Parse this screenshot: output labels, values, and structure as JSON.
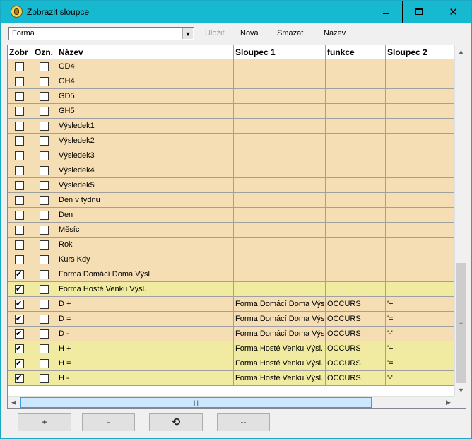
{
  "window": {
    "title": "Zobrazit sloupce",
    "minimize_icon": "minimize-icon",
    "maximize_icon": "maximize-icon",
    "close_icon": "close-icon"
  },
  "toolbar": {
    "combo_value": "Forma",
    "save_label": "Uložit",
    "new_label": "Nová",
    "delete_label": "Smazat",
    "name_label": "Název"
  },
  "columns": [
    "Zobr",
    "Ozn.",
    "Název",
    "Sloupec 1",
    "funkce",
    "Sloupec 2"
  ],
  "rows": [
    {
      "show": false,
      "mark": false,
      "name": "GD4",
      "col1": "",
      "func": "",
      "col2": "",
      "color": "tan"
    },
    {
      "show": false,
      "mark": false,
      "name": "GH4",
      "col1": "",
      "func": "",
      "col2": "",
      "color": "tan"
    },
    {
      "show": false,
      "mark": false,
      "name": "GD5",
      "col1": "",
      "func": "",
      "col2": "",
      "color": "tan"
    },
    {
      "show": false,
      "mark": false,
      "name": "GH5",
      "col1": "",
      "func": "",
      "col2": "",
      "color": "tan"
    },
    {
      "show": false,
      "mark": false,
      "name": "Výsledek1",
      "col1": "",
      "func": "",
      "col2": "",
      "color": "tan"
    },
    {
      "show": false,
      "mark": false,
      "name": "Výsledek2",
      "col1": "",
      "func": "",
      "col2": "",
      "color": "tan"
    },
    {
      "show": false,
      "mark": false,
      "name": "Výsledek3",
      "col1": "",
      "func": "",
      "col2": "",
      "color": "tan"
    },
    {
      "show": false,
      "mark": false,
      "name": "Výsledek4",
      "col1": "",
      "func": "",
      "col2": "",
      "color": "tan"
    },
    {
      "show": false,
      "mark": false,
      "name": "Výsledek5",
      "col1": "",
      "func": "",
      "col2": "",
      "color": "tan"
    },
    {
      "show": false,
      "mark": false,
      "name": "Den v týdnu",
      "col1": "",
      "func": "",
      "col2": "",
      "color": "tan"
    },
    {
      "show": false,
      "mark": false,
      "name": "Den",
      "col1": "",
      "func": "",
      "col2": "",
      "color": "tan"
    },
    {
      "show": false,
      "mark": false,
      "name": "Měsíc",
      "col1": "",
      "func": "",
      "col2": "",
      "color": "tan"
    },
    {
      "show": false,
      "mark": false,
      "name": "Rok",
      "col1": "",
      "func": "",
      "col2": "",
      "color": "tan"
    },
    {
      "show": false,
      "mark": false,
      "name": "Kurs Kdy",
      "col1": "",
      "func": "",
      "col2": "",
      "color": "tan"
    },
    {
      "show": true,
      "mark": false,
      "name": "Forma Domácí Doma Výsl.",
      "col1": "",
      "func": "",
      "col2": "",
      "color": "tan"
    },
    {
      "show": true,
      "mark": false,
      "name": "Forma Hosté Venku Výsl.",
      "col1": "",
      "func": "",
      "col2": "",
      "color": "yel"
    },
    {
      "show": true,
      "mark": false,
      "name": "D +",
      "col1": "Forma Domácí Doma Výsl.",
      "func": "OCCURS",
      "col2": "'+'",
      "color": "tan"
    },
    {
      "show": true,
      "mark": false,
      "name": "D =",
      "col1": "Forma Domácí Doma Výsl.",
      "func": "OCCURS",
      "col2": "'='",
      "color": "tan"
    },
    {
      "show": true,
      "mark": false,
      "name": "D -",
      "col1": "Forma Domácí Doma Výsl.",
      "func": "OCCURS",
      "col2": "'-'",
      "color": "tan"
    },
    {
      "show": true,
      "mark": false,
      "name": "H +",
      "col1": "Forma Hosté Venku Výsl.",
      "func": "OCCURS",
      "col2": "'+'",
      "color": "yel"
    },
    {
      "show": true,
      "mark": false,
      "name": "H =",
      "col1": "Forma Hosté Venku Výsl.",
      "func": "OCCURS",
      "col2": "'='",
      "color": "yel"
    },
    {
      "show": true,
      "mark": false,
      "name": "H -",
      "col1": "Forma Hosté Venku Výsl.",
      "func": "OCCURS",
      "col2": "'-'",
      "color": "yel"
    }
  ],
  "buttons": {
    "add_label": "+",
    "remove_label": "-",
    "refresh_icon": "refresh-icon",
    "clear_label": "--"
  },
  "colors": {
    "titlebar": "#17b9d1",
    "row_tan": "#f5deb3",
    "row_yellow": "#f0eba0"
  }
}
